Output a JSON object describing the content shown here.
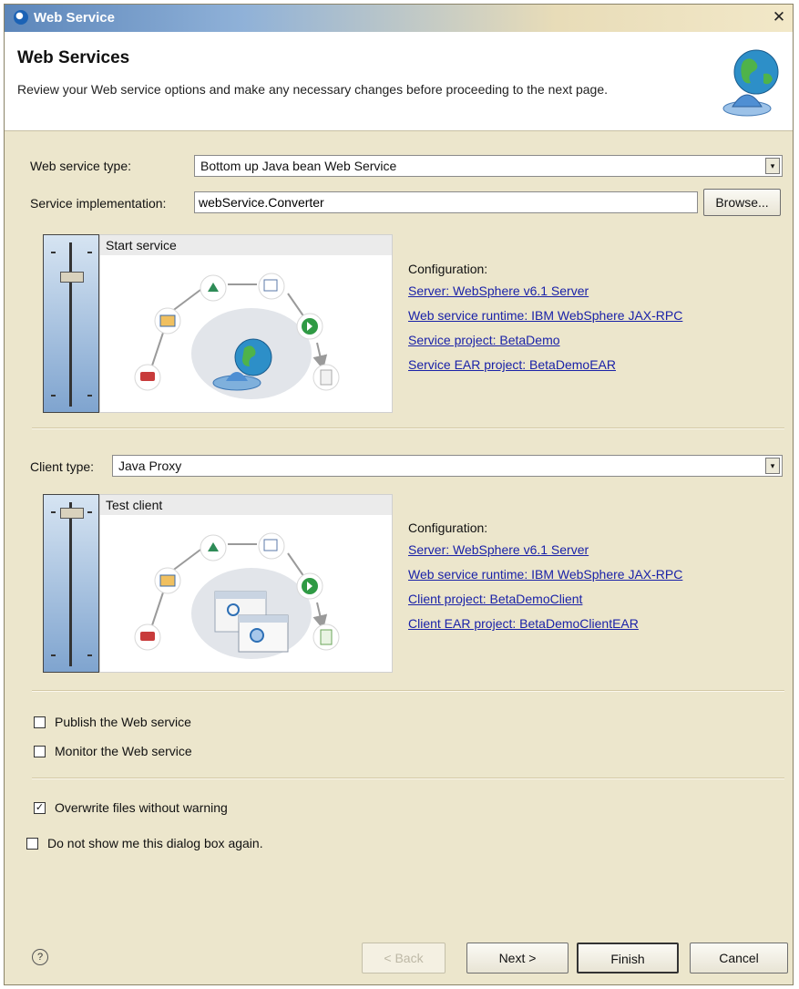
{
  "window": {
    "title": "Web Service",
    "close_glyph": "✕"
  },
  "header": {
    "title": "Web Services",
    "description": "Review your Web service options and make any necessary changes before proceeding to the next page."
  },
  "service": {
    "type_label": "Web service type:",
    "type_value": "Bottom up Java bean Web Service",
    "impl_label": "Service implementation:",
    "impl_value": "webService.Converter",
    "browse_label": "Browse...",
    "panel_title": "Start service",
    "config_heading": "Configuration:",
    "links": [
      "Server: WebSphere v6.1 Server",
      "Web service runtime: IBM WebSphere JAX-RPC",
      "Service project: BetaDemo",
      "Service EAR project: BetaDemoEAR"
    ]
  },
  "client": {
    "type_label": "Client type:",
    "type_value": "Java Proxy",
    "panel_title": "Test client",
    "config_heading": "Configuration:",
    "links": [
      "Server: WebSphere v6.1 Server",
      "Web service runtime: IBM WebSphere JAX-RPC",
      "Client project: BetaDemoClient",
      "Client EAR project: BetaDemoClientEAR"
    ]
  },
  "options": {
    "publish": {
      "label": "Publish the Web service",
      "checked": false
    },
    "monitor": {
      "label": "Monitor the Web service",
      "checked": false
    },
    "overwrite": {
      "label": "Overwrite files without warning",
      "checked": true
    },
    "dont_show": {
      "label": "Do not show me this dialog box again.",
      "checked": false
    }
  },
  "footer": {
    "help_glyph": "?",
    "back_label": "< Back",
    "next_label": "Next >",
    "finish_label": "Finish",
    "cancel_label": "Cancel"
  },
  "icons": {
    "app": "eclipse-icon",
    "header": "globe-icon",
    "combo_arrow": "▾",
    "check_mark": "✓"
  }
}
